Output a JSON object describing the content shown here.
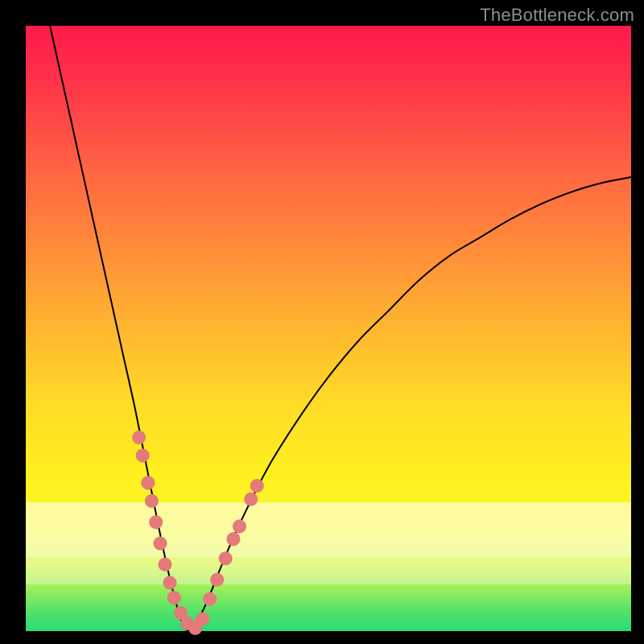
{
  "watermark": "TheBottleneck.com",
  "colors": {
    "dot": "#e47a7a",
    "curve": "#000000",
    "gradient_top": "#ff1a4a",
    "gradient_bottom": "#28db76"
  },
  "chart_data": {
    "type": "line",
    "title": "",
    "xlabel": "",
    "ylabel": "",
    "xlim": [
      0,
      100
    ],
    "ylim": [
      0,
      100
    ],
    "curve": {
      "name": "bottleneck-curve",
      "x": [
        4,
        6,
        8,
        10,
        12,
        14,
        16,
        18,
        20,
        22,
        23.5,
        25,
        26,
        27,
        28,
        30,
        32,
        35,
        40,
        45,
        50,
        55,
        60,
        65,
        70,
        75,
        80,
        85,
        90,
        95,
        100
      ],
      "y": [
        100,
        91,
        82,
        73,
        64,
        55,
        46,
        37,
        27,
        17,
        10,
        4,
        1,
        0,
        1,
        5,
        10,
        17,
        27,
        35,
        42,
        48,
        53,
        58,
        62,
        65,
        68,
        70.5,
        72.5,
        74,
        75
      ]
    },
    "series": [
      {
        "name": "markers-left",
        "x_scaled": [
          18.7,
          19.3,
          20.2,
          20.8,
          21.5,
          22.2,
          23.0,
          23.8,
          24.5,
          25.6,
          26.7,
          28.0
        ],
        "y_scaled": [
          32.0,
          29.0,
          24.5,
          21.5,
          18.0,
          14.5,
          11.0,
          8.0,
          5.5,
          3.0,
          1.3,
          0.5
        ]
      },
      {
        "name": "markers-right",
        "x_scaled": [
          29.2,
          30.4,
          31.6,
          33.0,
          34.3,
          35.3,
          37.2,
          38.2
        ],
        "y_scaled": [
          2.0,
          5.3,
          8.5,
          12.0,
          15.2,
          17.3,
          21.8,
          24.0
        ]
      }
    ],
    "annotations": []
  }
}
